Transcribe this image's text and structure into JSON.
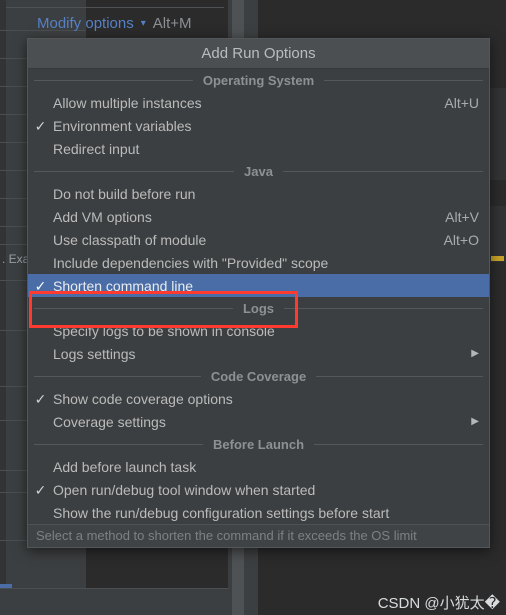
{
  "toolbar": {
    "modify_options_label": "Modify options",
    "modify_options_accel": "Alt+M",
    "chevron_icon": "chevron-down-icon"
  },
  "menu": {
    "title": "Add Run Options",
    "status_hint": "Select a method to shorten the command if it exceeds the OS limit",
    "sections": [
      {
        "header": "Operating System",
        "items": [
          {
            "label": "Allow multiple instances",
            "accel": "Alt+U",
            "checked": false,
            "submenu": false,
            "selected": false
          },
          {
            "label": "Environment variables",
            "accel": "",
            "checked": true,
            "submenu": false,
            "selected": false
          },
          {
            "label": "Redirect input",
            "accel": "",
            "checked": false,
            "submenu": false,
            "selected": false
          }
        ]
      },
      {
        "header": "Java",
        "items": [
          {
            "label": "Do not build before run",
            "accel": "",
            "checked": false,
            "submenu": false,
            "selected": false
          },
          {
            "label": "Add VM options",
            "accel": "Alt+V",
            "checked": false,
            "submenu": false,
            "selected": false
          },
          {
            "label": "Use classpath of module",
            "accel": "Alt+O",
            "checked": false,
            "submenu": false,
            "selected": false
          },
          {
            "label": "Include dependencies with \"Provided\" scope",
            "accel": "",
            "checked": false,
            "submenu": false,
            "selected": false
          },
          {
            "label": "Shorten command line",
            "accel": "",
            "checked": true,
            "submenu": false,
            "selected": true
          }
        ]
      },
      {
        "header": "Logs",
        "items": [
          {
            "label": "Specify logs to be shown in console",
            "accel": "",
            "checked": false,
            "submenu": false,
            "selected": false
          },
          {
            "label": "Logs settings",
            "accel": "",
            "checked": false,
            "submenu": true,
            "selected": false
          }
        ]
      },
      {
        "header": "Code Coverage",
        "items": [
          {
            "label": "Show code coverage options",
            "accel": "",
            "checked": true,
            "submenu": false,
            "selected": false
          },
          {
            "label": "Coverage settings",
            "accel": "",
            "checked": false,
            "submenu": true,
            "selected": false
          }
        ]
      },
      {
        "header": "Before Launch",
        "items": [
          {
            "label": "Add before launch task",
            "accel": "",
            "checked": false,
            "submenu": false,
            "selected": false
          },
          {
            "label": "Open run/debug tool window when started",
            "accel": "",
            "checked": true,
            "submenu": false,
            "selected": false
          },
          {
            "label": "Show the run/debug configuration settings before start",
            "accel": "",
            "checked": false,
            "submenu": false,
            "selected": false
          }
        ]
      }
    ]
  },
  "annotation": {
    "highlight_color": "#ff3b30",
    "target_item": "Shorten command line"
  },
  "background": {
    "partial_text": ". Exa"
  },
  "watermark": {
    "text": "CSDN @小犹太�"
  },
  "colors": {
    "menu_bg": "#3c3f41",
    "menu_title_bg": "#4b4f51",
    "selection_blue": "#4a6da7",
    "link_blue": "#5781c4",
    "text": "#bbbbbb",
    "section_header_text": "#8e9194",
    "editor_bg": "#2b2b2b",
    "marker_yellow": "#c9a227"
  },
  "glyphs": {
    "check": "✓",
    "submenu_arrow": "▶",
    "chevron_down": "⌄"
  }
}
